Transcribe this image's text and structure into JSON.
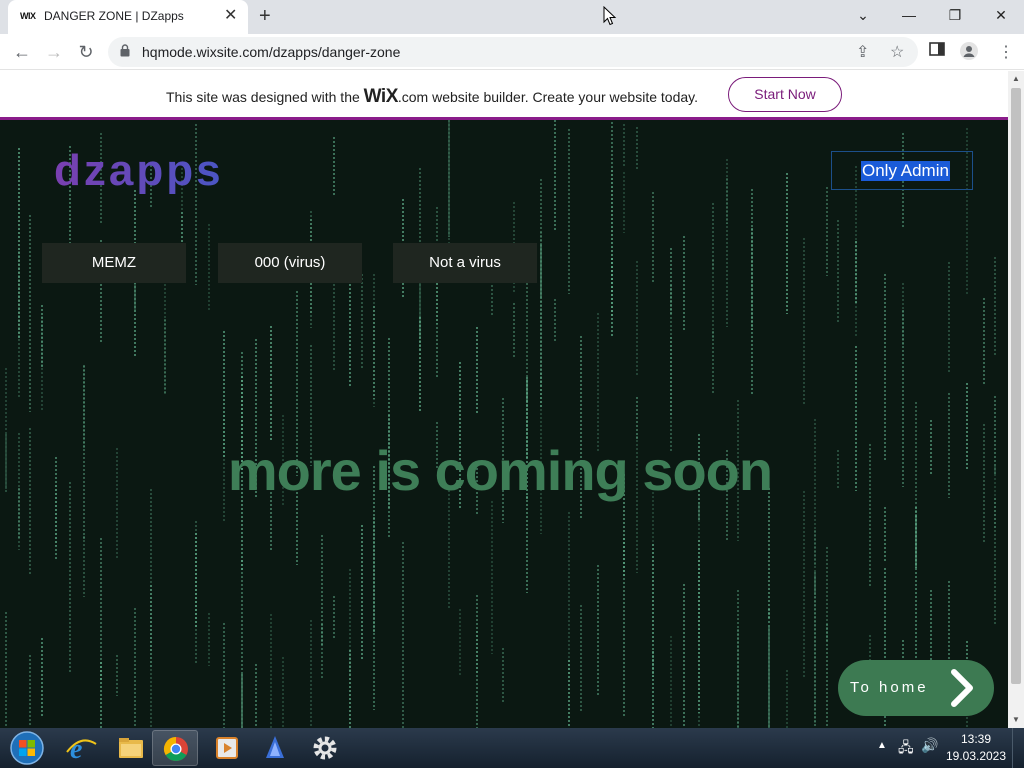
{
  "browser": {
    "tab_title": "DANGER ZONE | DZapps",
    "tab_favicon": "WIX",
    "url": "hqmode.wixsite.com/dzapps/danger-zone"
  },
  "wix_banner": {
    "text_before": "This site was designed with the ",
    "logo": "WiX",
    "text_after": ".com website builder. Create your website today.",
    "cta": "Start Now"
  },
  "site": {
    "logo": "dzapps",
    "admin_label": "Only Admin",
    "menu": [
      "MEMZ",
      "000 (virus)",
      "Not a virus"
    ],
    "headline": "more is coming soon",
    "to_home": "To home"
  },
  "taskbar": {
    "time": "13:39",
    "date": "19.03.2023"
  },
  "colors": {
    "page_bg": "#0b1812",
    "matrix_green": "#5fae8a",
    "headline": "#3e7e57",
    "wix_accent": "#7a1b7a",
    "to_home_bg": "#3d7a52"
  }
}
